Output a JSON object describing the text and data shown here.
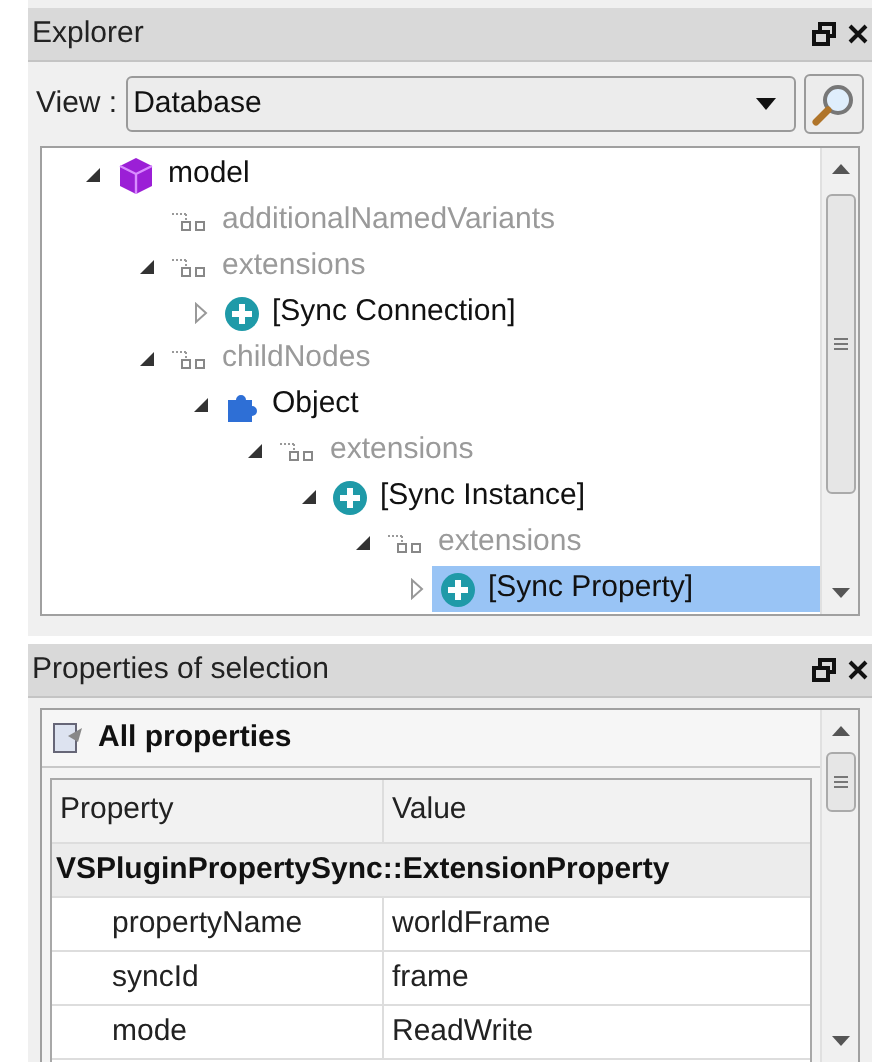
{
  "explorer": {
    "title": "Explorer",
    "view_label": "View :",
    "view_value": "Database",
    "tree": [
      {
        "label": "model",
        "kind": "model",
        "expanded": true,
        "selected": false,
        "children": [
          {
            "label": "additionalNamedVariants",
            "kind": "list",
            "selected": false
          },
          {
            "label": "extensions",
            "kind": "list",
            "expanded": true,
            "selected": false,
            "children": [
              {
                "label": "[Sync Connection]",
                "kind": "plus",
                "expanded": false,
                "selected": false
              }
            ]
          },
          {
            "label": "childNodes",
            "kind": "list",
            "expanded": true,
            "selected": false,
            "children": [
              {
                "label": "Object",
                "kind": "object",
                "expanded": true,
                "selected": false,
                "children": [
                  {
                    "label": "extensions",
                    "kind": "list",
                    "expanded": true,
                    "selected": false,
                    "children": [
                      {
                        "label": "[Sync Instance]",
                        "kind": "plus",
                        "expanded": true,
                        "selected": false,
                        "children": [
                          {
                            "label": "extensions",
                            "kind": "list",
                            "expanded": true,
                            "selected": false,
                            "children": [
                              {
                                "label": "[Sync Property]",
                                "kind": "plus",
                                "expanded": false,
                                "selected": true
                              }
                            ]
                          }
                        ]
                      }
                    ]
                  }
                ]
              }
            ]
          }
        ]
      }
    ]
  },
  "properties": {
    "title": "Properties of selection",
    "section": "All properties",
    "table": {
      "columns": [
        "Property",
        "Value"
      ],
      "group": "VSPluginPropertySync::ExtensionProperty",
      "rows": [
        {
          "property": "propertyName",
          "value": "worldFrame"
        },
        {
          "property": "syncId",
          "value": "frame"
        },
        {
          "property": "mode",
          "value": "ReadWrite"
        }
      ]
    }
  }
}
